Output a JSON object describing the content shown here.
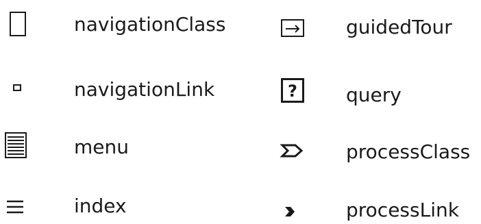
{
  "legend": {
    "left": [
      {
        "label": "navigationClass",
        "icon": "large-rectangle-icon"
      },
      {
        "label": "navigationLink",
        "icon": "small-square-icon"
      },
      {
        "label": "menu",
        "icon": "lined-box-icon"
      },
      {
        "label": "index",
        "icon": "three-lines-icon"
      }
    ],
    "right": [
      {
        "label": "guidedTour",
        "icon": "arrow-in-box-icon"
      },
      {
        "label": "query",
        "icon": "question-box-icon"
      },
      {
        "label": "processClass",
        "icon": "double-chevron-icon"
      },
      {
        "label": "processLink",
        "icon": "chevron-icon"
      }
    ]
  },
  "colors": {
    "ink": "#1a1a1a",
    "background": "#ffffff"
  }
}
